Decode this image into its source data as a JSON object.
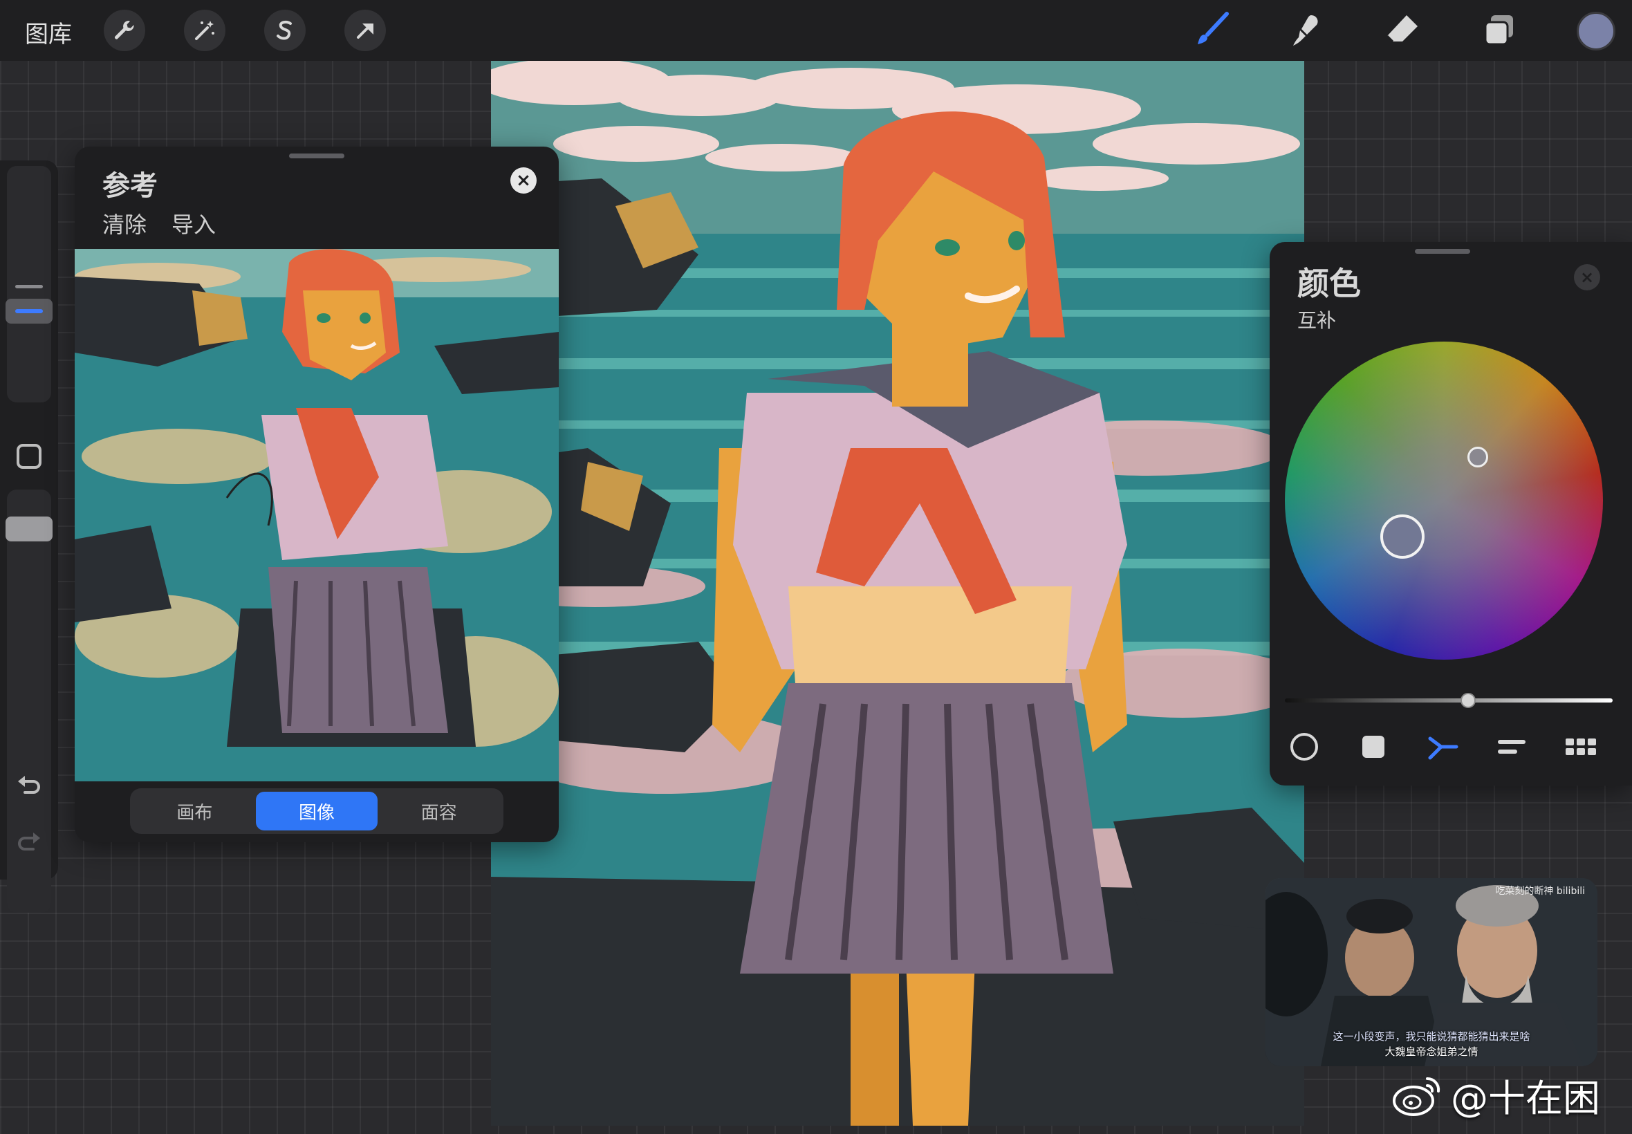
{
  "topbar": {
    "gallery_label": "图库",
    "left_tools": [
      {
        "name": "actions",
        "icon": "wrench-icon"
      },
      {
        "name": "adjustments",
        "icon": "magic-wand-icon"
      },
      {
        "name": "selection",
        "icon": "selection-s-icon"
      },
      {
        "name": "transform",
        "icon": "arrow-cursor-icon"
      }
    ],
    "right_tools": [
      {
        "name": "brush",
        "icon": "brush-icon",
        "active": true
      },
      {
        "name": "smudge",
        "icon": "smudge-icon",
        "active": false
      },
      {
        "name": "eraser",
        "icon": "eraser-icon",
        "active": false
      },
      {
        "name": "layers",
        "icon": "layers-icon",
        "active": false
      }
    ],
    "current_color": "#7b82a8",
    "accent_color": "#3d7bff"
  },
  "sidebar": {
    "undo_icon": "undo-icon",
    "redo_icon": "redo-icon"
  },
  "reference_panel": {
    "title": "参考",
    "actions": [
      "清除",
      "导入"
    ],
    "close_icon": "close-icon",
    "tabs": [
      {
        "label": "画布",
        "active": false
      },
      {
        "label": "图像",
        "active": true
      },
      {
        "label": "面容",
        "active": false
      }
    ]
  },
  "color_panel": {
    "title": "颜色",
    "mode": "互补",
    "close_icon": "close-icon",
    "main_color": "#727894",
    "complement_color": "#8a8890",
    "modes": [
      {
        "name": "disc",
        "icon": "circle-icon",
        "active": false
      },
      {
        "name": "classic",
        "icon": "square-icon",
        "active": false
      },
      {
        "name": "harmony",
        "icon": "harmony-icon",
        "active": true
      },
      {
        "name": "value",
        "icon": "sliders-icon",
        "active": false
      },
      {
        "name": "palettes",
        "icon": "grid-icon",
        "active": false
      }
    ]
  },
  "video_overlay": {
    "brand": "吃菜刻的断神 bilibili",
    "subtitle_line1": "这一小段变声，我只能说猜都能猜出来是啥",
    "subtitle_line2": "大魏皇帝念姐弟之情"
  },
  "watermark": {
    "text": "@十在困",
    "icon": "weibo-icon"
  }
}
